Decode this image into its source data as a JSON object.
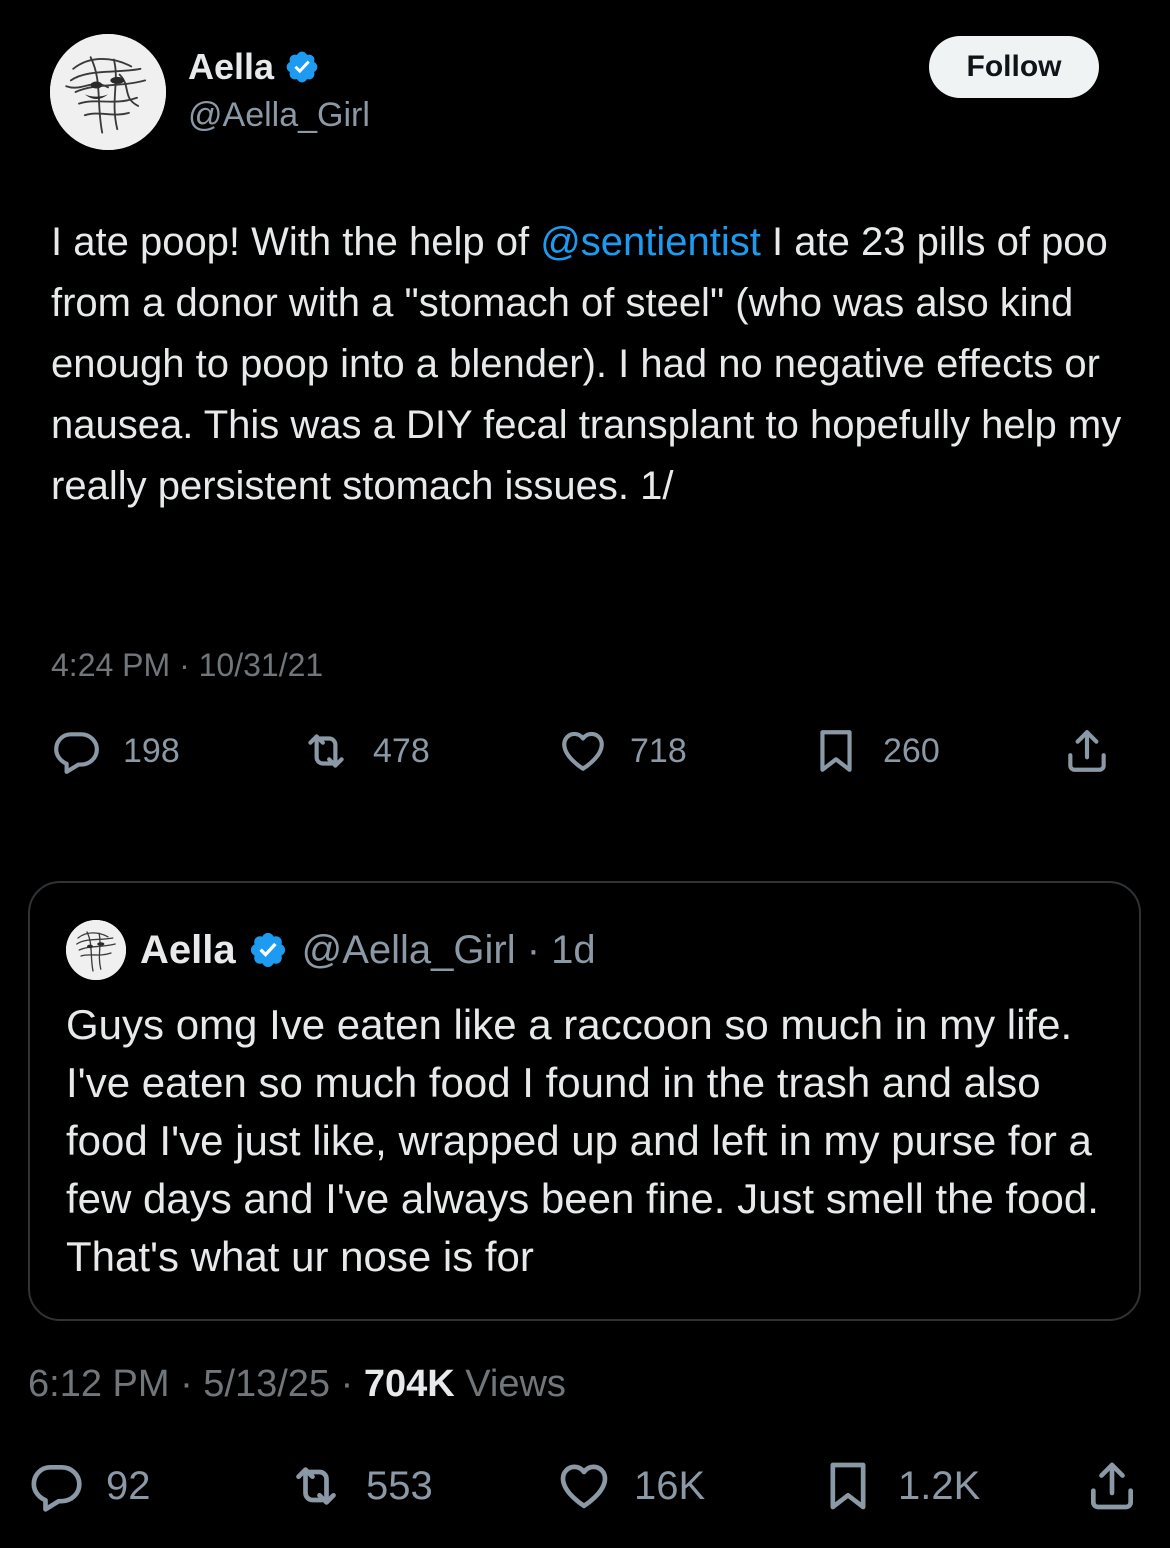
{
  "embedded_tweet": {
    "display_name": "Aella",
    "handle": "@Aella_Girl",
    "follow_label": "Follow",
    "text_before_mention": "I ate poop! With the help of ",
    "mention": "@sentientist",
    "text_after_mention": " I ate 23 pills of poo from a donor with a \"stomach of steel\" (who was also kind enough to poop into a blender). I had no negative effects or nausea. This was a DIY fecal transplant to hopefully help my really persistent stomach issues. 1/",
    "timestamp": "4:24 PM · 10/31/21",
    "stats": {
      "replies": "198",
      "reposts": "478",
      "likes": "718",
      "bookmarks": "260"
    }
  },
  "quoted_tweet": {
    "display_name": "Aella",
    "handle_time": "@Aella_Girl · 1d",
    "text": "Guys omg Ive eaten like a raccoon so much in my life. I've eaten so much food I found in the trash and also food I've just like, wrapped up and left in my purse for a few days and I've always been fine. Just smell the food. That's what ur nose is for"
  },
  "post_meta": {
    "time": "6:12 PM · 5/13/25 · ",
    "views_count": "704K",
    "views_label": " Views"
  },
  "post_stats": {
    "replies": "92",
    "reposts": "553",
    "likes": "16K",
    "bookmarks": "1.2K"
  },
  "icons": {
    "reply": "reply-icon",
    "repost": "repost-icon",
    "like": "heart-icon",
    "bookmark": "bookmark-icon",
    "share": "share-icon",
    "verified": "verified-badge-icon"
  },
  "colors": {
    "background": "#000000",
    "text_primary": "#e7e9ea",
    "text_secondary": "#8b98a5",
    "link": "#1d9bf0",
    "verified": "#1d9bf0",
    "follow_button_bg": "#eff3f4"
  }
}
